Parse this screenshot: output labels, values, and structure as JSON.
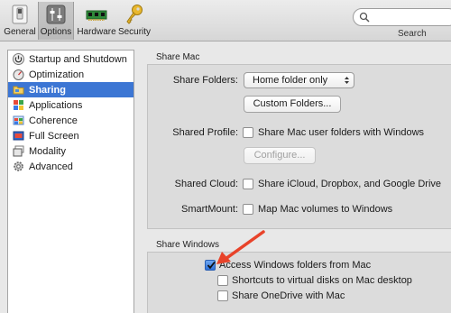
{
  "toolbar": {
    "items": [
      {
        "label": "General",
        "icon": "switch-icon",
        "selected": false
      },
      {
        "label": "Options",
        "icon": "sliders-icon",
        "selected": true
      },
      {
        "label": "Hardware",
        "icon": "memory-chip-icon",
        "selected": false
      },
      {
        "label": "Security",
        "icon": "key-icon",
        "selected": false
      }
    ],
    "search": {
      "placeholder": "",
      "label": "Search"
    }
  },
  "sidebar": {
    "items": [
      {
        "label": "Startup and Shutdown",
        "icon": "power-icon",
        "selected": false
      },
      {
        "label": "Optimization",
        "icon": "speedometer-icon",
        "selected": false
      },
      {
        "label": "Sharing",
        "icon": "folder-icon",
        "selected": true
      },
      {
        "label": "Applications",
        "icon": "apps-grid-icon",
        "selected": false
      },
      {
        "label": "Coherence",
        "icon": "windows-flag-icon",
        "selected": false
      },
      {
        "label": "Full Screen",
        "icon": "fullscreen-icon",
        "selected": false
      },
      {
        "label": "Modality",
        "icon": "window-stack-icon",
        "selected": false
      },
      {
        "label": "Advanced",
        "icon": "gear-icon",
        "selected": false
      }
    ]
  },
  "share_mac": {
    "title": "Share Mac",
    "share_folders_label": "Share Folders:",
    "share_folders_value": "Home folder only",
    "custom_folders_button": "Custom Folders...",
    "shared_profile_label": "Shared Profile:",
    "shared_profile_checkbox": "Share Mac user folders with Windows",
    "shared_profile_checked": false,
    "configure_button": "Configure...",
    "shared_cloud_label": "Shared Cloud:",
    "shared_cloud_checkbox": "Share iCloud, Dropbox, and Google Drive",
    "shared_cloud_checked": false,
    "smartmount_label": "SmartMount:",
    "smartmount_checkbox": "Map Mac volumes to Windows",
    "smartmount_checked": false
  },
  "share_windows": {
    "title": "Share Windows",
    "access_checkbox": "Access Windows folders from Mac",
    "access_checked": true,
    "shortcuts_checkbox": "Shortcuts to virtual disks on Mac desktop",
    "shortcuts_checked": false,
    "onedrive_checkbox": "Share OneDrive with Mac",
    "onedrive_checked": false
  },
  "colors": {
    "selection": "#3c76d4",
    "annotation_arrow": "#e8432a"
  }
}
